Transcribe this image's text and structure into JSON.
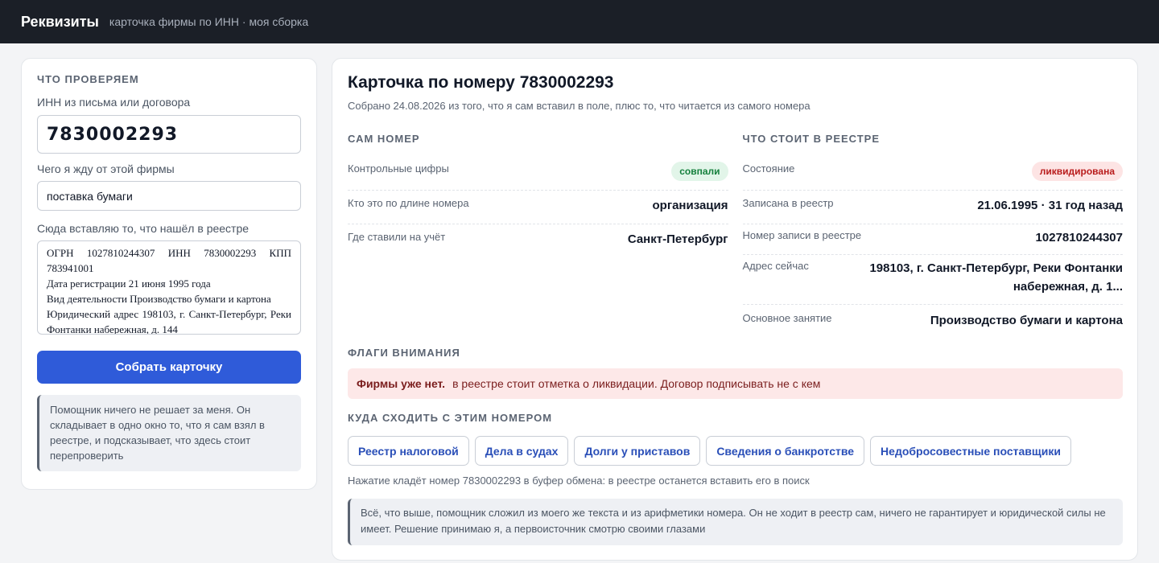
{
  "app": {
    "title": "Реквизиты",
    "subtitle": "карточка фирмы по ИНН · моя сборка"
  },
  "form": {
    "section_title": "Что проверяем",
    "inn_label": "ИНН из письма или договора",
    "inn_value": "7830002293",
    "expect_label": "Чего я жду от этой фирмы",
    "expect_value": "поставка бумаги",
    "paste_label": "Сюда вставляю то, что нашёл в реестре",
    "paste_value": "ОГРН 1027810244307 ИНН 7830002293 КПП 783941001\nДата регистрации 21 июня 1995 года\nВид деятельности Производство бумаги и картона\nЮридический адрес 198103, г. Санкт-Петербург, Реки Фонтанки набережная, д. 144",
    "submit_label": "Собрать карточку",
    "note": "Помощник ничего не решает за меня. Он складывает в одно окно то, что я сам взял в реестре, и подсказывает, что здесь стоит перепроверить"
  },
  "card": {
    "title": "Карточка по номеру 7830002293",
    "subtitle": "Собрано 24.08.2026 из того, что я сам вставил в поле, плюс то, что читается из самого номера",
    "number_section": {
      "title": "Сам номер",
      "check_label": "Контрольные цифры",
      "check_badge": "совпали",
      "length_label": "Кто это по длине номера",
      "length_value": "организация",
      "region_label": "Где ставили на учёт",
      "region_value": "Санкт-Петербург"
    },
    "registry_section": {
      "title": "Что стоит в реестре",
      "state_label": "Состояние",
      "state_badge": "ликвидирована",
      "registered_label": "Записана в реестр",
      "registered_value": "21.06.1995 · 31 год назад",
      "record_label": "Номер записи в реестре",
      "record_value": "1027810244307",
      "address_label": "Адрес сейчас",
      "address_value": "198103, г. Санкт-Петербург, Реки Фонтанки набережная, д. 1...",
      "activity_label": "Основное занятие",
      "activity_value": "Производство бумаги и картона"
    },
    "flags": {
      "title": "Флаги внимания",
      "flag_bold": "Фирмы уже нет.",
      "flag_text": "в реестре стоит отметка о ликвидации. Договор подписывать не с кем"
    },
    "links": {
      "title": "Куда сходить с этим номером",
      "buttons": [
        "Реестр налоговой",
        "Дела в судах",
        "Долги у приставов",
        "Сведения о банкротстве",
        "Недобросовестные поставщики"
      ],
      "hint": "Нажатие кладёт номер 7830002293 в буфер обмена: в реестре останется вставить его в поиск"
    },
    "note": "Всё, что выше, помощник сложил из моего же текста и из арифметики номера. Он не ходит в реестр сам, ничего не гарантирует и юридической силы не имеет. Решение принимаю я, а первоисточник смотрю своими глазами"
  },
  "colors": {
    "topbar": "#1b1f27",
    "primary": "#2f5bd9",
    "ok": "#15803d",
    "danger": "#b91c1c",
    "flag_bg": "#fde8e8"
  }
}
